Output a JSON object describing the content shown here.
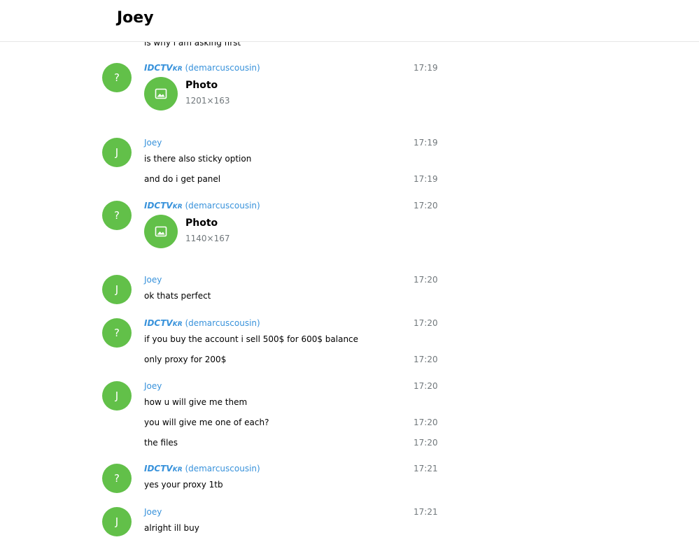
{
  "header": {
    "title": "Joey"
  },
  "history": {
    "cut_text": "is why i am asking first",
    "messages": [
      {
        "avatar": "?",
        "from_a": "IDCTV",
        "from_b": "KR",
        "from_c": " (demarcuscousin)",
        "time": "17:19",
        "photo": {
          "title": "Photo",
          "size": "1201×163"
        }
      },
      {
        "avatar": "J",
        "from": "Joey",
        "time": "17:19",
        "text": "is there also sticky option"
      },
      {
        "text": "and do i get panel",
        "time": "17:19"
      },
      {
        "avatar": "?",
        "from_a": "IDCTV",
        "from_b": "KR",
        "from_c": " (demarcuscousin)",
        "time": "17:20",
        "photo": {
          "title": "Photo",
          "size": "1140×167"
        }
      },
      {
        "avatar": "J",
        "from": "Joey",
        "time": "17:20",
        "text": "ok thats perfect"
      },
      {
        "avatar": "?",
        "from_a": "IDCTV",
        "from_b": "KR",
        "from_c": " (demarcuscousin)",
        "time": "17:20",
        "text": "if you buy the account i sell 500$ for 600$ balance"
      },
      {
        "text": "only proxy for 200$",
        "time": "17:20"
      },
      {
        "avatar": "J",
        "from": "Joey",
        "time": "17:20",
        "text": "how u will give me them"
      },
      {
        "text": "you will give me one of each?",
        "time": "17:20"
      },
      {
        "text": "the files",
        "time": "17:20"
      },
      {
        "avatar": "?",
        "from_a": "IDCTV",
        "from_b": "KR",
        "from_c": " (demarcuscousin)",
        "time": "17:21",
        "text": "yes your proxy 1tb"
      },
      {
        "avatar": "J",
        "from": "Joey",
        "time": "17:21",
        "text": "alright ill buy"
      }
    ]
  },
  "icons": {
    "photo": "image-icon"
  },
  "colors": {
    "avatar": "#62c049",
    "name": "#3892db",
    "time": "#70777b"
  }
}
